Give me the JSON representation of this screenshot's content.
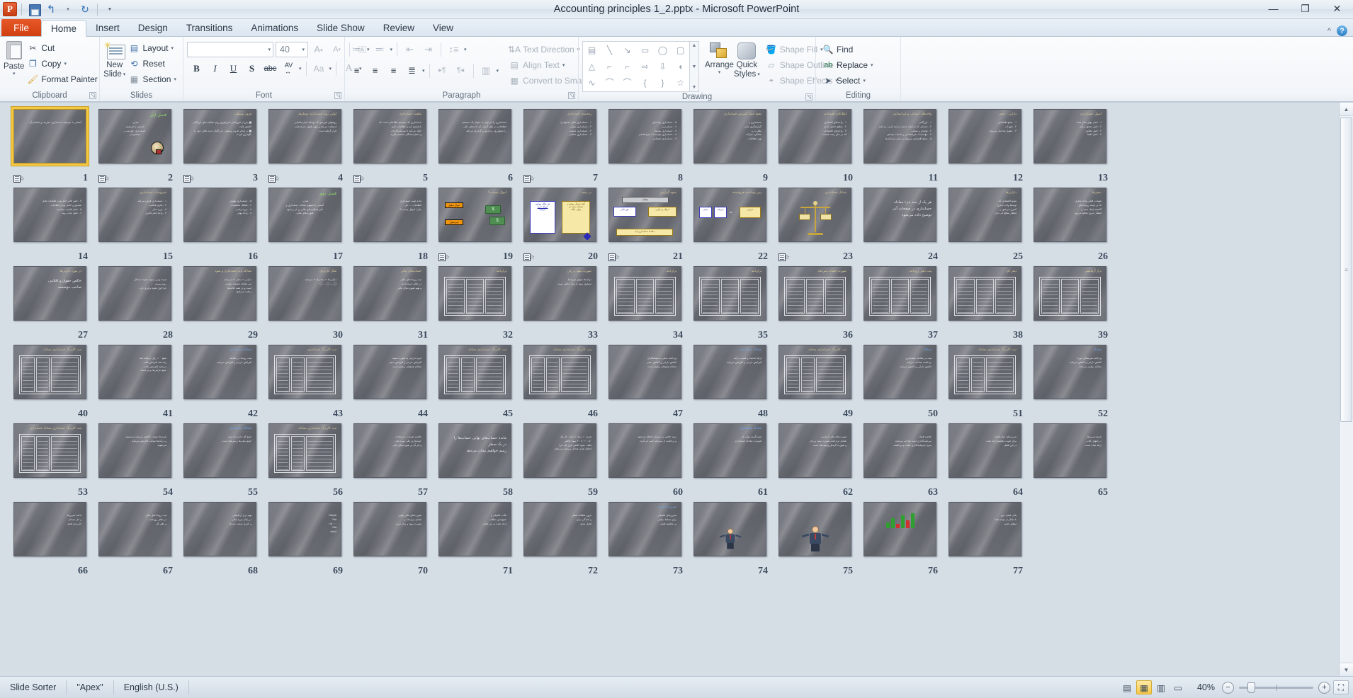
{
  "window": {
    "title": "Accounting principles 1_2.pptx  -  Microsoft PowerPoint",
    "logo": "P",
    "quick_access": [
      {
        "name": "save-button",
        "icon": "save-icon",
        "label": ""
      },
      {
        "name": "undo-button",
        "icon": "undo-icon",
        "label": "↰"
      },
      {
        "name": "redo-button",
        "icon": "redo-icon",
        "label": "↻"
      },
      {
        "name": "customize-qat-button",
        "icon": "chevron-down-icon",
        "label": "▾"
      }
    ],
    "controls": {
      "minimize": "—",
      "restore": "❐",
      "close": "✕"
    }
  },
  "tabs": {
    "file": "File",
    "items": [
      "Home",
      "Insert",
      "Design",
      "Transitions",
      "Animations",
      "Slide Show",
      "Review",
      "View"
    ],
    "active": "Home",
    "collapse_ribbon": "^",
    "help": "?"
  },
  "ribbon": {
    "groups": [
      {
        "name": "clipboard",
        "label": "Clipboard",
        "has_launcher": true,
        "big": {
          "label_line1": "Paste",
          "icon": "paste-icon",
          "caret": "▾"
        },
        "items": [
          {
            "label": "Cut",
            "icon": "scissors-icon",
            "caret": ""
          },
          {
            "label": "Copy",
            "icon": "copy-icon",
            "caret": "▾"
          },
          {
            "label": "Format Painter",
            "icon": "format-painter-icon",
            "caret": ""
          }
        ]
      },
      {
        "name": "slides",
        "label": "Slides",
        "has_launcher": false,
        "big": {
          "label_line1": "New",
          "label_line2": "Slide",
          "icon": "new-slide-icon",
          "caret": "▾"
        },
        "items": [
          {
            "label": "Layout",
            "icon": "layout-icon",
            "caret": "▾"
          },
          {
            "label": "Reset",
            "icon": "reset-icon",
            "caret": ""
          },
          {
            "label": "Section",
            "icon": "section-icon",
            "caret": "▾"
          }
        ]
      },
      {
        "name": "font",
        "label": "Font",
        "has_launcher": true,
        "font_name": "",
        "font_size": "40",
        "row1": [
          "▾",
          "A↑",
          "A↓",
          "clear-formatting"
        ],
        "row2": [
          "B",
          "I",
          "U",
          "S",
          "abc",
          "AV",
          "Aa",
          "A"
        ]
      },
      {
        "name": "paragraph",
        "label": "Paragraph",
        "has_launcher": true,
        "row1": [
          "bullets",
          "numbering",
          "decrease-indent",
          "increase-indent",
          "line-spacing"
        ],
        "row2": [
          "align-left",
          "align-center",
          "align-right",
          "justify",
          "ltr-text",
          "rtl-text",
          "columns"
        ],
        "items": [
          {
            "label": "Text Direction",
            "icon": "text-direction-icon",
            "caret": "▾"
          },
          {
            "label": "Align Text",
            "icon": "align-text-icon",
            "caret": "▾"
          },
          {
            "label": "Convert to SmartArt",
            "icon": "smartart-icon",
            "caret": "▾"
          }
        ]
      },
      {
        "name": "drawing",
        "label": "Drawing",
        "has_launcher": true,
        "shapes": [
          "▤",
          "╲",
          "↘",
          "▭",
          "◯",
          "▢",
          "△",
          "⌐",
          "⌐",
          "⇨",
          "⇩",
          "◖",
          "∿",
          "⌒",
          "⌒",
          "{",
          "}",
          "☆"
        ],
        "arrange": {
          "label": "Arrange",
          "caret": "▾",
          "icon": "arrange-icon"
        },
        "quick_styles": {
          "label_line1": "Quick",
          "label_line2": "Styles",
          "caret": "▾",
          "icon": "quick-styles-icon"
        },
        "items": [
          {
            "label": "Shape Fill",
            "icon": "shape-fill-icon",
            "caret": "▾"
          },
          {
            "label": "Shape Outline",
            "icon": "shape-outline-icon",
            "caret": "▾"
          },
          {
            "label": "Shape Effects",
            "icon": "shape-effects-icon",
            "caret": "▾"
          }
        ]
      },
      {
        "name": "editing",
        "label": "Editing",
        "has_launcher": false,
        "items": [
          {
            "label": "Find",
            "icon": "find-icon",
            "caret": ""
          },
          {
            "label": "Replace",
            "icon": "replace-icon",
            "caret": "▾"
          },
          {
            "label": "Select",
            "icon": "select-icon",
            "caret": "▾"
          }
        ]
      }
    ]
  },
  "sorter": {
    "selected_slide": 1,
    "columns": 13,
    "slides": [
      {
        "n": 1,
        "kind": "title-only",
        "title": "",
        "body": "آشنایی با تاریخچه حسابداری، تعاریف و مفاهیم آن",
        "titleColor": "white",
        "trans": true
      },
      {
        "n": 2,
        "kind": "cover",
        "title": "فصل اول",
        "titleColor": "green",
        "body": "هدف :\nآشنایی با تاریخچه\nحسابداری، تعاریف و\nمفاهیم آن",
        "graphic": "bulb",
        "trans": true
      },
      {
        "n": 3,
        "kind": "bullets",
        "title": "فرون وسطی",
        "body": "■ پس از فروپاشی امپراتوری روم، فعالیت‌های بازرگانی کاهش یافت\n■ در اواخر قرون وسطی، بازرگانان جدید دفاتر خود را نگهداری کردند",
        "trans": true
      },
      {
        "n": 4,
        "kind": "bullets",
        "title": "اولین روند حسابداری دوطرفه",
        "body": "روشهای فرزندی که توسط تجار ایتالیایی\nاستفاده می‌شد و مورد قبول حسابداران\nقرار گرفته است",
        "trans": true
      },
      {
        "n": 5,
        "kind": "bullets",
        "title": "ماهیت حسابداری",
        "body": "حسابداری یک سیستم اطلاعاتی است که\nبا فراهم کردن اطلاعات لازم\nکمک می‌کند تا سرمایه‌گذاران\nو اعتباردهندگان تصمیم بگیرند",
        "trans": true
      },
      {
        "n": 6,
        "kind": "bullets",
        "title": "",
        "body": "حسابداری را می‌توان به عنوان یک سیستم\nاطلاعاتی در نظر گرفت که داده‌های مالی\nرا جمع‌آوری، پردازش و گزارش می‌کند",
        "trans": false
      },
      {
        "n": 7,
        "kind": "bullets",
        "title": "رده‌بندی حسابداری",
        "body": "۱ - حسابداری مالی (عمومی)\n۲ - حسابداری دولتی\n۳ - حسابداری صنعتی\n۴ - حسابداری مالیاتی",
        "trans": true
      },
      {
        "n": 8,
        "kind": "bullets",
        "title": "",
        "body": "۵ - حسابداری بودجه‌ای\n۶ - حسابرسی\n۷ - حسابداری بیمه‌ها\n۸ - حسابداری مؤسسات غیرانتفاعی\n۹ - حسابداری اجتماعی",
        "trans": false
      },
      {
        "n": 9,
        "kind": "bullets",
        "title": "نحوه عمل آموزش حسابداری",
        "body": "حسابداری و\nگزارشگری مالی\nنظارت بر\nعملکرد شرکت\nتهیه اطلاعات",
        "trans": false
      },
      {
        "n": 10,
        "kind": "bullets",
        "title": "اطلاعات اقتصادی",
        "body": "۱ - واحدهای اقتصادی\n۲ - منافع حاصل از آن\n۳ - واحدهای اقتصادی\nکه در حال رشد هستند",
        "trans": false
      },
      {
        "n": 11,
        "kind": "bullets",
        "title": "واحدهای انتفاعی و غیرانتفاعی",
        "body": "۱ - بازرگانی\n۲ - خدماتی که از ارائه خدمت درآمد کسب می‌کنند\n۳ - تولیدی و صنعتی\n۴ - مؤسسات غیرانتفاعی و خدمات بیمه‌ای\n۵ - منابع اقتصادی مربوط به سایر سازمان‌ها",
        "trans": false
      },
      {
        "n": 12,
        "kind": "bullets",
        "title": "دارایی - بدهی",
        "body": "۱ - منابع اقتصادی\n۲ - تعهدات\n۳ - حقوق صاحبان سرمایه",
        "trans": false
      },
      {
        "n": 13,
        "kind": "bullets",
        "title": "اصول حسابداری",
        "body": "۱ - اصل بهای تمام شده\n۲ - اصل تحقق درآمد\n۳ - اصل تطابق\n۴ - اصل افشا",
        "trans": false
      },
      {
        "n": 14,
        "kind": "bullets",
        "title": "",
        "body": "۳ - اصل قابل اتکا بودن اطلاعات   قابل\nتصدیق و کامل بودن اطلاعات\n۵ - اصل قابلیت مقایسه\n۶ - اصل ثبات رویه",
        "trans": false
      },
      {
        "n": 15,
        "kind": "bullets",
        "title": "مفروضات حسابداری",
        "body": "۱ - حسابداری فرض می‌کند\n۲ - تداوم فعالیت\n۳ - دوره مالی\n۴ - واحد اندازه‌گیری",
        "trans": false
      },
      {
        "n": 16,
        "kind": "bullets",
        "title": "",
        "body": "۵ - حسابداری تعهدی\n۶ - تفکیک شخصیت\n۷ - دوره زمانی\n۸ - واحد پولی",
        "trans": false
      },
      {
        "n": 17,
        "kind": "cover",
        "title": "فصل دوم",
        "titleColor": "green",
        "body": "هدف :\nآشنایی با مفهوم معادله حسابداری و\nتأثیر فعالیت‌های مالی بر آن و نحوه\nصورت‌های مالی",
        "trans": false
      },
      {
        "n": 18,
        "kind": "bullets",
        "title": "",
        "body": "ماده اولیه حسابداری\nاطلاعات — حل\nمال / اموال چیست؟",
        "trans": false
      },
      {
        "n": 19,
        "kind": "diagram-money",
        "title": "اموال چیست؟",
        "trans": true
      },
      {
        "n": 20,
        "kind": "diagram-cards",
        "title": "در نتیجه :",
        "trans": true
      },
      {
        "n": 21,
        "kind": "diagram-equation",
        "title": "نحوه گزارش",
        "trans": true
      },
      {
        "n": 22,
        "kind": "diagram-boxes",
        "title": "پس بهداشت فروشنده",
        "trans": false
      },
      {
        "n": 23,
        "kind": "scale",
        "title": "معادل حسابداری",
        "trans": true
      },
      {
        "n": 24,
        "kind": "bullets",
        "title": "",
        "body": "هر یک از سه جزء معادله\nحسابداری در صفحات آتی\nتوضیح داده می‌شود",
        "bigBody": true,
        "trans": false
      },
      {
        "n": 25,
        "kind": "bullets",
        "title": "دارایی‌ها",
        "body": "منابع اقتصادی که\nتوسط واحد تجاری\nکنترل می‌شود و\nانتظار منافع آتی دارد",
        "trans": false
      },
      {
        "n": 26,
        "kind": "bullets",
        "title": "بدهی‌ها",
        "body": "تعهدات فعلی واحد تجاری\nکه در نتیجه رویدادهای\nگذشته ایجاد شده و\nانتظار خروج منافع می‌رود",
        "trans": false
      },
      {
        "n": 27,
        "kind": "bullets",
        "title": "در مورد دارایی‌ها",
        "body": "خالص حقوق و اقلامی\nصاحب مؤسسه",
        "bigBody": true,
        "trans": false
      },
      {
        "n": 28,
        "kind": "bullets",
        "title": "",
        "body": "جزء دوم و سوم: نحوه استدلال\nرویه بیست\nجزء اول نحوه برابری دارد",
        "trans": false
      },
      {
        "n": 29,
        "kind": "bullets",
        "title": "معادله پایه حسابداری و سود",
        "body": "دارایی = بدهی + سرمایه\nاین معادله همیشه برقرار\nاست و در همه حالت‌ها\nرعایت می‌شود",
        "hasRed": true,
        "trans": false
      },
      {
        "n": 30,
        "kind": "bullets",
        "title": "مثال کاربردی",
        "body": "دارایی‌ها = بدهی‌ها + سرمایه\n◯ — ◯ — ◯",
        "trans": false
      },
      {
        "n": 31,
        "kind": "bullets",
        "title": "حساب‌های مالی",
        "body": "ثبت رویدادهای مالی\nدر دفاتر حسابداری\nو تهیه صورت‌های مالی",
        "trans": false
      },
      {
        "n": 32,
        "kind": "table",
        "title": "ترازنامه",
        "trans": false
      },
      {
        "n": 33,
        "kind": "bullets",
        "title": "صورت سود و زیان",
        "body": "درآمدها منهای هزینه‌ها\nمساوی سود یا زیان خالص دوره",
        "hasRed": true,
        "trans": false
      },
      {
        "n": 34,
        "kind": "table",
        "title": "ترازنامه",
        "trans": false
      },
      {
        "n": 35,
        "kind": "table",
        "title": "ترازنامه",
        "trans": false
      },
      {
        "n": 36,
        "kind": "table",
        "title": "صورت حساب سرمایه",
        "trans": false
      },
      {
        "n": 37,
        "kind": "table",
        "title": "ثبت دفتر روزنامه",
        "trans": false
      },
      {
        "n": 38,
        "kind": "table",
        "title": "دفتر کل",
        "trans": false
      },
      {
        "n": 39,
        "kind": "table",
        "title": "تراز آزمایشی",
        "trans": false
      },
      {
        "n": 40,
        "kind": "table-wide",
        "title": "ثبت کاربرگ حسابداری معادله",
        "trans": false
      },
      {
        "n": 41,
        "kind": "bullets",
        "title": "",
        "body": "مبلغ ۱۰۰ ریال دریافت شد\nوجه نقد افزایش یافت\nسرمایه افزایش یافت\nجمع دارایی‌ها برابر است",
        "trans": false
      },
      {
        "n": 42,
        "kind": "bullets",
        "title": "معادله حسابداری",
        "titleColor": "blue",
        "body": "ثبت رویداد در معادله\nافزایش دارایی و افزایش سرمایه",
        "trans": false
      },
      {
        "n": 43,
        "kind": "table-wide",
        "title": "ثبت کاربرگ حسابداری",
        "trans": false
      },
      {
        "n": 44,
        "kind": "bullets",
        "title": "",
        "body": "خرید دارایی به صورت نسیه\nافزایش دارایی و افزایش بدهی\nمعادله همچنان برقرار است",
        "trans": false
      },
      {
        "n": 45,
        "kind": "table-wide",
        "title": "ثبت کاربرگ حسابداری معادله",
        "trans": false
      },
      {
        "n": 46,
        "kind": "table-wide",
        "title": "ثبت کاربرگ حسابداری معادله",
        "trans": false
      },
      {
        "n": 47,
        "kind": "bullets",
        "title": "",
        "body": "پرداخت بدهی به بستانکاران\nکاهش دارایی و کاهش بدهی\nمعادله همچنان برقرار است",
        "trans": false
      },
      {
        "n": 48,
        "kind": "bullets",
        "title": "معادله حسابداری",
        "titleColor": "blue",
        "body": "ارائه خدمت و کسب درآمد\nافزایش دارایی و افزایش سرمایه",
        "trans": false
      },
      {
        "n": 49,
        "kind": "table-wide",
        "title": "ثبت کاربرگ حسابداری معادله",
        "trans": false
      },
      {
        "n": 50,
        "kind": "bullets",
        "title": "معادله",
        "titleColor": "blue",
        "body": "ثبت در معادله حسابداری\nبرداشت صاحب سرمایه\nکاهش دارایی و کاهش سرمایه",
        "trans": false
      },
      {
        "n": 51,
        "kind": "table-wide",
        "title": "ثبت کاربرگ حسابداری معادله",
        "trans": false
      },
      {
        "n": 52,
        "kind": "bullets",
        "title": "معادله",
        "titleColor": "blue",
        "body": "پرداخت هزینه‌های دوره\nکاهش دارایی و کاهش سرمایه\nمعادله برقرار می‌ماند",
        "trans": false
      },
      {
        "n": 53,
        "kind": "table-wide",
        "title": "ثبت کاربرگ حسابداری معادله حسابداری",
        "trans": false
      },
      {
        "n": 54,
        "kind": "bullets",
        "title": "",
        "body": "هزینه‌ها موجب کاهش سرمایه می‌شوند\nو درآمدها موجب افزایش سرمایه\nمی‌شوند",
        "trans": false
      },
      {
        "n": 55,
        "kind": "bullets",
        "title": "معادله حسابداری",
        "titleColor": "blue",
        "body": "جمع کل دارایی‌ها برابر\nجمع بدهی‌ها و سرمایه است",
        "trans": false
      },
      {
        "n": 56,
        "kind": "table-wide",
        "title": "ثبت کاربرگ حسابداری معادله",
        "trans": false
      },
      {
        "n": 57,
        "kind": "bullets",
        "title": "",
        "body": "خلاصه تغییرات در معادله\nحسابداری طی دوره مالی\nو اثر آن بر صورت‌های مالی",
        "trans": false
      },
      {
        "n": 58,
        "kind": "bullets",
        "title": "",
        "body": "مانده حساب‌های نهایی حساب‌ها را\nدر یک سطر\nرسم خواهیم نشان می‌دهد",
        "bigBody": true,
        "trans": false
      },
      {
        "n": 59,
        "kind": "bullets",
        "title": "",
        "body": "هزینه ۱۰ ریال / درآمد ۵۰ ریال\n۵۰ - ۱۰ = ۴۰ سود خالص\nنکته : سود خالص باری یک جزء\nاضافه شدن شامل سرمایه می‌باشد",
        "hasRed": true,
        "trans": false
      },
      {
        "n": 60,
        "kind": "bullets",
        "title": "",
        "body": "سود خالص به سرمایه اضافه می‌شود\nو برداشت از سرمایه کسر می‌گردد",
        "trans": false
      },
      {
        "n": 61,
        "kind": "bullets",
        "title": "معادله حسابداری",
        "titleColor": "blue",
        "body": "نتیجه‌گیری نهایی از\nتغییرات معادله حسابداری",
        "trans": false
      },
      {
        "n": 62,
        "kind": "bullets",
        "title": "",
        "body": "صورت‌های مالی اساسی\nشامل ترازنامه، صورت سود و زیان\nو صورت گردش وجوه نقد است",
        "trans": false
      },
      {
        "n": 63,
        "kind": "bullets",
        "title": "",
        "body": "خلاصه فصل\nسرمایه‌گذاری اولیه صاحب سرمایه\nبدون سرمایه‌گذاری مجدد و برداشت",
        "trans": false
      },
      {
        "n": 64,
        "kind": "bullets",
        "title": "",
        "body": "تمرین‌های پایان فصل\nبرای تثبیت مفاهیم ارائه شده\nدر این فصل",
        "trans": false
      },
      {
        "n": 65,
        "kind": "bullets",
        "title": "",
        "body": "پاسخ تمرین‌ها\nدر انتهای کتاب\nارائه شده است",
        "trans": false
      },
      {
        "n": 66,
        "kind": "bullets",
        "title": "",
        "body": "ادامه تمرین‌ها\nو حل مسائل\nکاربردی فصل",
        "trans": false
      },
      {
        "n": 67,
        "kind": "bullets",
        "title": "",
        "body": "ثبت رویدادهای مالی\nدر دفاتر روزنامه\nو دفتر کل",
        "trans": false
      },
      {
        "n": 68,
        "kind": "bullets",
        "title": "",
        "body": "تهیه تراز آزمایشی\nدر پایان دوره مالی\nو کنترل صحت ثبت‌ها",
        "trans": false
      },
      {
        "n": 69,
        "kind": "numbers",
        "title": "",
        "body": "۳۵۵٫۵۵\n۳۵۵\n۱۱۵۰۰۰\n۴۵۵\n۸۵۵٫۵",
        "trans": false
      },
      {
        "n": 70,
        "kind": "bullets",
        "title": "",
        "body": "صورت‌های مالی نهایی\nشامل ترازنامه و\nصورت سود و زیان دوره",
        "trans": false
      },
      {
        "n": 71,
        "kind": "bullets",
        "title": "",
        "body": "نکات تکمیلی و\nجمع‌بندی مطالب\nارائه شده در این فصل",
        "trans": false
      },
      {
        "n": 72,
        "kind": "bullets",
        "title": "",
        "body": "مرور مطالب فصل\nو آمادگی برای\nفصل بعدی",
        "trans": false
      },
      {
        "n": 73,
        "kind": "bullets",
        "title": "تمرین کاربردی",
        "titleColor": "blue",
        "body": "تمرین‌های تکمیلی\nبرای تسلط بیشتر\nبر مفاهیم فصل",
        "trans": false
      },
      {
        "n": 74,
        "kind": "person",
        "title": "",
        "trans": false
      },
      {
        "n": 75,
        "kind": "person2",
        "title": "",
        "trans": false
      },
      {
        "n": 76,
        "kind": "chart",
        "title": "",
        "trans": false
      },
      {
        "n": 77,
        "kind": "bullets",
        "title": "",
        "body": "پایان فصل دوم\nبا تشکر از توجه شما\nموفق باشید",
        "trans": false
      }
    ]
  },
  "statusbar": {
    "view_name": "Slide Sorter",
    "theme": "\"Apex\"",
    "language": "English (U.S.)",
    "views": [
      {
        "name": "normal-view-button",
        "label": "▤",
        "active": false
      },
      {
        "name": "slide-sorter-view-button",
        "label": "▦",
        "active": true
      },
      {
        "name": "reading-view-button",
        "label": "▥",
        "active": false
      },
      {
        "name": "slide-show-button",
        "label": "▭",
        "active": false
      }
    ],
    "zoom": "40%",
    "zoom_out": "−",
    "zoom_in": "+",
    "fit_to_window": "⛶"
  }
}
